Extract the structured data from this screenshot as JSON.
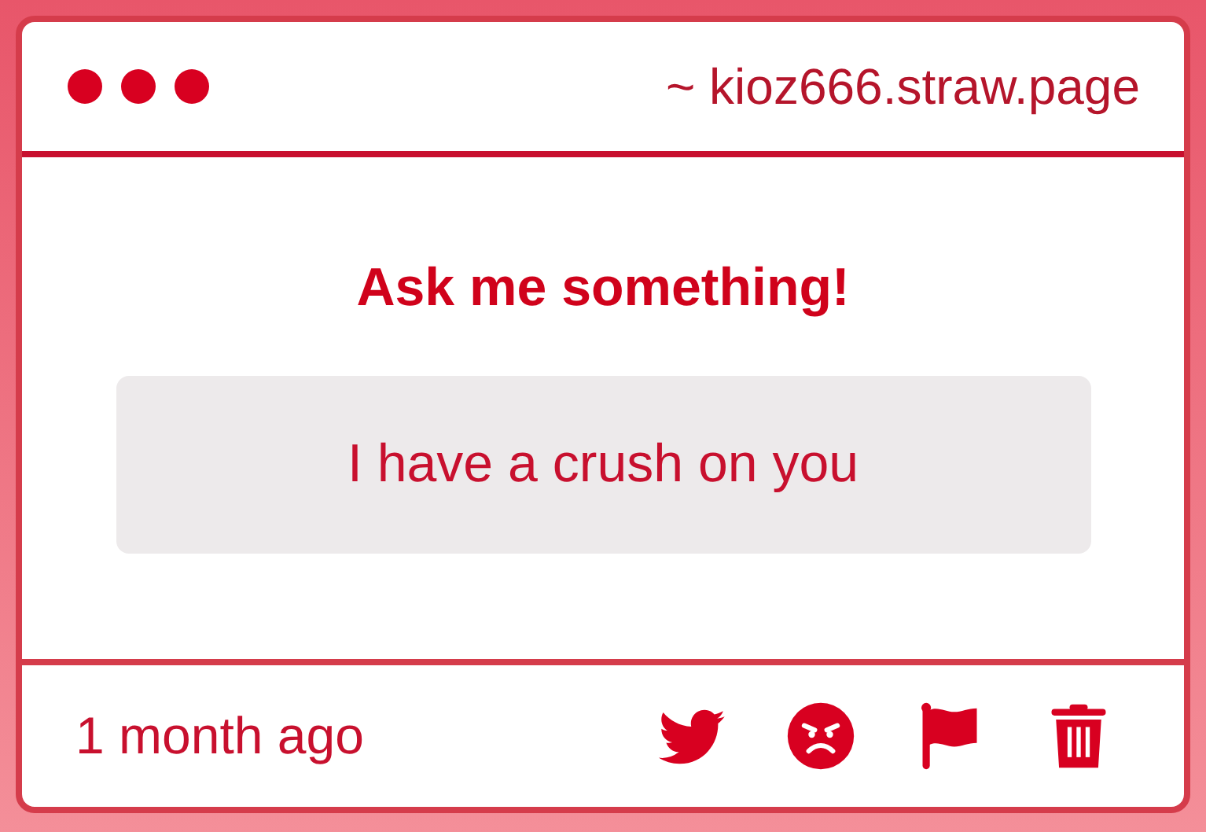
{
  "header": {
    "url": "~ kioz666.straw.page"
  },
  "question": {
    "title": "Ask me something!",
    "message": "I have a crush on you"
  },
  "footer": {
    "time": "1 month ago"
  }
}
